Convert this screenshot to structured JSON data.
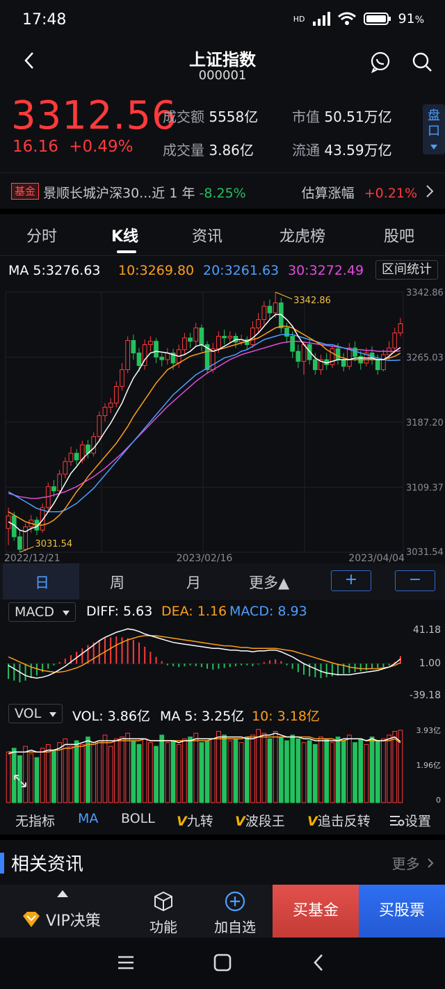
{
  "status": {
    "time": "17:48",
    "battery": "91",
    "battery_unit": "%",
    "network": "HD"
  },
  "header": {
    "title": "上证指数",
    "code": "000001"
  },
  "quote": {
    "price": "3312.56",
    "change": "16.16",
    "change_pct": "+0.49%",
    "turnover_label": "成交额",
    "turnover": "5558亿",
    "volume_label": "成交量",
    "volume": "3.86亿",
    "mktcap_label": "市值",
    "mktcap": "50.51万亿",
    "float_label": "流通",
    "float": "43.59万亿",
    "pankou": [
      "盘",
      "口"
    ]
  },
  "fund": {
    "badge": "基金",
    "name": "景顺长城沪深30...近 1 年",
    "return": "-8.25%",
    "est_label": "估算涨幅",
    "est_value": "+0.21%"
  },
  "tabs": [
    "分时",
    "K线",
    "资讯",
    "龙虎榜",
    "股吧"
  ],
  "ma_legend": {
    "ma5": "MA 5:3276.63",
    "ma10": "10:3269.80",
    "ma20": "20:3261.63",
    "ma30": "30:3272.49",
    "range_btn": "区间统计"
  },
  "periods": [
    "日",
    "周",
    "月",
    "更多▲"
  ],
  "zoom": {
    "plus": "+",
    "minus": "−"
  },
  "macd": {
    "selector": "MACD",
    "diff": "DIFF: 5.63",
    "dea": "DEA: 1.16",
    "macd": "MACD: 8.93",
    "ticks": [
      "41.18",
      "1.00",
      "-39.18"
    ]
  },
  "vol": {
    "selector": "VOL",
    "vol": "VOL: 3.86亿",
    "ma5": "MA 5: 3.25亿",
    "ma10": "10: 3.18亿",
    "ticks": [
      "3.93亿",
      "1.96亿",
      "0"
    ]
  },
  "indicators": [
    "无指标",
    "MA",
    "BOLL",
    "九转",
    "波段王",
    "追击反转",
    "设置"
  ],
  "news": {
    "title": "相关资讯",
    "more": "更多"
  },
  "actions": {
    "vip": "VIP决策",
    "func": "功能",
    "add": "加自选",
    "buy_fund": "买基金",
    "buy_stock": "买股票"
  },
  "colors": {
    "up": "#ff3b3b",
    "down": "#23c15d",
    "ma5": "#ffffff",
    "ma10": "#ff9f1a",
    "ma20": "#4d9fff",
    "ma30": "#e04ddb"
  },
  "chart_data": [
    {
      "type": "candlestick",
      "title": "",
      "x_labels": [
        "2022/12/21",
        "2023/02/16",
        "2023/04/04"
      ],
      "y_ticks": [
        "3342.86",
        "3265.03",
        "3187.20",
        "3109.37",
        "3031.54"
      ],
      "ylim": [
        3031.54,
        3342.86
      ],
      "high_label": "3342.86",
      "low_label": "3031.54",
      "bars": [
        [
          3060,
          3075,
          3040,
          3085
        ],
        [
          3075,
          3050,
          3045,
          3080
        ],
        [
          3050,
          3035,
          3031.54,
          3058
        ],
        [
          3035,
          3062,
          3033,
          3066
        ],
        [
          3062,
          3070,
          3055,
          3076
        ],
        [
          3070,
          3058,
          3052,
          3074
        ],
        [
          3058,
          3085,
          3055,
          3090
        ],
        [
          3085,
          3110,
          3082,
          3115
        ],
        [
          3110,
          3105,
          3098,
          3118
        ],
        [
          3105,
          3125,
          3100,
          3130
        ],
        [
          3125,
          3140,
          3120,
          3145
        ],
        [
          3140,
          3150,
          3135,
          3158
        ],
        [
          3150,
          3142,
          3136,
          3155
        ],
        [
          3142,
          3160,
          3138,
          3165
        ],
        [
          3160,
          3150,
          3144,
          3166
        ],
        [
          3150,
          3170,
          3146,
          3175
        ],
        [
          3170,
          3195,
          3165,
          3200
        ],
        [
          3195,
          3205,
          3188,
          3210
        ],
        [
          3205,
          3210,
          3198,
          3216
        ],
        [
          3210,
          3230,
          3205,
          3236
        ],
        [
          3230,
          3250,
          3225,
          3258
        ],
        [
          3250,
          3285,
          3246,
          3290
        ],
        [
          3285,
          3270,
          3262,
          3292
        ],
        [
          3270,
          3255,
          3248,
          3276
        ],
        [
          3255,
          3280,
          3250,
          3286
        ],
        [
          3280,
          3284,
          3272,
          3290
        ],
        [
          3284,
          3265,
          3258,
          3288
        ],
        [
          3265,
          3262,
          3254,
          3270
        ],
        [
          3262,
          3270,
          3256,
          3276
        ],
        [
          3270,
          3258,
          3250,
          3275
        ],
        [
          3258,
          3274,
          3252,
          3280
        ],
        [
          3274,
          3288,
          3268,
          3294
        ],
        [
          3288,
          3284,
          3276,
          3294
        ],
        [
          3284,
          3300,
          3278,
          3306
        ],
        [
          3300,
          3280,
          3272,
          3304
        ],
        [
          3280,
          3250,
          3245,
          3284
        ],
        [
          3250,
          3275,
          3246,
          3282
        ],
        [
          3275,
          3290,
          3270,
          3296
        ],
        [
          3290,
          3288,
          3280,
          3298
        ],
        [
          3288,
          3290,
          3282,
          3296
        ],
        [
          3290,
          3283,
          3276,
          3294
        ],
        [
          3283,
          3286,
          3279,
          3292
        ],
        [
          3286,
          3280,
          3274,
          3290
        ],
        [
          3280,
          3300,
          3276,
          3308
        ],
        [
          3300,
          3310,
          3294,
          3318
        ],
        [
          3310,
          3326,
          3304,
          3332
        ],
        [
          3326,
          3318,
          3310,
          3334
        ],
        [
          3318,
          3330,
          3312,
          3342.86
        ],
        [
          3330,
          3300,
          3294,
          3336
        ],
        [
          3300,
          3290,
          3282,
          3306
        ],
        [
          3290,
          3272,
          3264,
          3296
        ],
        [
          3272,
          3260,
          3252,
          3280
        ],
        [
          3260,
          3280,
          3244,
          3284
        ],
        [
          3280,
          3262,
          3256,
          3288
        ],
        [
          3262,
          3250,
          3244,
          3270
        ],
        [
          3250,
          3262,
          3244,
          3268
        ],
        [
          3262,
          3256,
          3250,
          3270
        ],
        [
          3256,
          3275,
          3252,
          3280
        ],
        [
          3275,
          3262,
          3256,
          3282
        ],
        [
          3262,
          3254,
          3248,
          3270
        ],
        [
          3254,
          3276,
          3250,
          3282
        ],
        [
          3276,
          3266,
          3260,
          3284
        ],
        [
          3266,
          3258,
          3250,
          3272
        ],
        [
          3258,
          3270,
          3254,
          3276
        ],
        [
          3270,
          3262,
          3256,
          3278
        ],
        [
          3262,
          3250,
          3244,
          3268
        ],
        [
          3250,
          3268,
          3248,
          3274
        ],
        [
          3268,
          3276,
          3262,
          3284
        ],
        [
          3276,
          3294,
          3270,
          3300
        ],
        [
          3294,
          3305,
          3290,
          3312
        ]
      ],
      "ma5": [
        3068,
        3064,
        3058,
        3056,
        3060,
        3062,
        3070,
        3080,
        3090,
        3102,
        3114,
        3126,
        3134,
        3143,
        3150,
        3156,
        3165,
        3176,
        3186,
        3198,
        3210,
        3226,
        3240,
        3250,
        3262,
        3270,
        3272,
        3271,
        3270,
        3268,
        3266,
        3268,
        3272,
        3278,
        3280,
        3276,
        3272,
        3274,
        3278,
        3282,
        3286,
        3286,
        3284,
        3288,
        3294,
        3302,
        3310,
        3316,
        3316,
        3310,
        3302,
        3290,
        3280,
        3272,
        3264,
        3260,
        3258,
        3260,
        3262,
        3262,
        3262,
        3264,
        3264,
        3264,
        3264,
        3262,
        3262,
        3266,
        3272,
        3276.63
      ],
      "ma10": [
        3080,
        3076,
        3072,
        3068,
        3066,
        3064,
        3064,
        3066,
        3070,
        3076,
        3084,
        3094,
        3104,
        3112,
        3122,
        3130,
        3138,
        3146,
        3154,
        3162,
        3172,
        3182,
        3194,
        3204,
        3214,
        3224,
        3234,
        3242,
        3250,
        3254,
        3258,
        3262,
        3266,
        3268,
        3270,
        3272,
        3272,
        3274,
        3276,
        3278,
        3280,
        3282,
        3284,
        3286,
        3288,
        3292,
        3296,
        3300,
        3302,
        3302,
        3300,
        3296,
        3292,
        3288,
        3284,
        3280,
        3274,
        3270,
        3266,
        3264,
        3262,
        3262,
        3262,
        3262,
        3262,
        3262,
        3262,
        3264,
        3266,
        3269.8
      ],
      "ma20": [
        3104,
        3100,
        3096,
        3092,
        3088,
        3084,
        3082,
        3080,
        3080,
        3080,
        3082,
        3086,
        3090,
        3096,
        3102,
        3108,
        3116,
        3124,
        3132,
        3140,
        3148,
        3156,
        3164,
        3172,
        3180,
        3188,
        3196,
        3204,
        3212,
        3220,
        3226,
        3232,
        3238,
        3244,
        3248,
        3252,
        3256,
        3260,
        3264,
        3266,
        3268,
        3272,
        3274,
        3278,
        3282,
        3286,
        3288,
        3290,
        3292,
        3292,
        3292,
        3290,
        3288,
        3286,
        3284,
        3282,
        3280,
        3280,
        3278,
        3276,
        3274,
        3272,
        3270,
        3268,
        3266,
        3264,
        3262,
        3261,
        3261,
        3261.63
      ],
      "ma30": [
        3102,
        3100,
        3098,
        3097,
        3096,
        3096,
        3097,
        3098,
        3100,
        3102,
        3104,
        3107,
        3110,
        3114,
        3118,
        3122,
        3127,
        3132,
        3138,
        3144,
        3150,
        3157,
        3164,
        3171,
        3178,
        3185,
        3192,
        3199,
        3206,
        3212,
        3218,
        3224,
        3230,
        3236,
        3241,
        3246,
        3250,
        3254,
        3258,
        3262,
        3265,
        3268,
        3270,
        3272,
        3274,
        3276,
        3278,
        3280,
        3282,
        3283,
        3284,
        3284,
        3283,
        3282,
        3281,
        3280,
        3279,
        3278,
        3277,
        3276,
        3275,
        3274,
        3274,
        3273,
        3273,
        3272,
        3272,
        3272,
        3272,
        3272.49
      ]
    },
    {
      "type": "bar",
      "name": "MACD",
      "ylim": [
        -39.18,
        41.18
      ],
      "hist": [
        -18,
        -20,
        -22,
        -20,
        -17,
        -14,
        -10,
        -6,
        -2,
        2,
        6,
        10,
        14,
        18,
        22,
        25,
        28,
        30,
        31,
        32,
        31,
        30,
        28,
        25,
        20,
        14,
        8,
        3,
        -2,
        -3,
        -4,
        -3,
        -2,
        -3,
        -4,
        -6,
        -7,
        -6,
        -5,
        -4,
        -3,
        -2,
        -2,
        -3,
        -1,
        2,
        4,
        5,
        3,
        -2,
        -6,
        -10,
        -13,
        -15,
        -16,
        -17,
        -16,
        -15,
        -14,
        -12,
        -11,
        -10,
        -9,
        -8,
        -6,
        -5,
        -4,
        -2,
        2,
        8.93
      ],
      "diff": [
        -2,
        -6,
        -10,
        -14,
        -16,
        -17,
        -16,
        -14,
        -11,
        -7,
        -3,
        2,
        7,
        12,
        17,
        22,
        27,
        31,
        34,
        37,
        39,
        41,
        40,
        38,
        35,
        33,
        31,
        29,
        27,
        25,
        24,
        23,
        22,
        21,
        20,
        19,
        18,
        18,
        17,
        16,
        16,
        15,
        15,
        14,
        15,
        15,
        16,
        16,
        14,
        11,
        8,
        4,
        0,
        -3,
        -6,
        -9,
        -11,
        -12,
        -13,
        -13,
        -13,
        -12,
        -11,
        -10,
        -9,
        -8,
        -6,
        -4,
        0,
        5.63
      ],
      "dea": [
        8,
        5,
        2,
        -1,
        -4,
        -6,
        -8,
        -9,
        -10,
        -10,
        -9,
        -7,
        -5,
        -2,
        2,
        6,
        10,
        14,
        18,
        22,
        25,
        28,
        30,
        32,
        33,
        33,
        33,
        32,
        31,
        30,
        29,
        28,
        27,
        26,
        25,
        24,
        23,
        22,
        21,
        21,
        20,
        19,
        19,
        18,
        18,
        18,
        18,
        18,
        17,
        16,
        15,
        13,
        11,
        9,
        7,
        5,
        3,
        1,
        -1,
        -2,
        -4,
        -5,
        -6,
        -6,
        -6,
        -6,
        -5,
        -4,
        -2,
        1.16
      ]
    },
    {
      "type": "bar",
      "name": "VOL",
      "ylim": [
        0,
        3.93
      ],
      "values": [
        2.7,
        2.9,
        2.5,
        3.0,
        2.6,
        2.4,
        2.9,
        3.1,
        2.8,
        3.2,
        3.4,
        3.0,
        3.3,
        3.1,
        3.5,
        3.2,
        3.3,
        3.6,
        3.0,
        3.4,
        3.5,
        3.7,
        3.3,
        3.1,
        3.4,
        3.2,
        3.0,
        3.6,
        3.2,
        3.3,
        3.1,
        3.4,
        3.5,
        3.7,
        3.2,
        3.3,
        3.4,
        3.8,
        3.6,
        3.3,
        3.4,
        3.2,
        3.5,
        3.6,
        3.9,
        3.7,
        3.4,
        3.8,
        3.5,
        3.3,
        3.6,
        3.4,
        3.2,
        3.3,
        3.1,
        3.5,
        3.4,
        3.2,
        3.5,
        3.3,
        3.6,
        3.2,
        3.4,
        3.1,
        3.5,
        3.3,
        3.4,
        3.6,
        3.8,
        3.86
      ],
      "ma5": [
        2.6,
        2.7,
        2.7,
        2.7,
        2.8,
        2.7,
        2.7,
        2.8,
        2.8,
        2.9,
        3.1,
        3.1,
        3.1,
        3.2,
        3.3,
        3.2,
        3.3,
        3.3,
        3.3,
        3.3,
        3.4,
        3.4,
        3.4,
        3.4,
        3.4,
        3.3,
        3.3,
        3.3,
        3.3,
        3.3,
        3.2,
        3.3,
        3.3,
        3.4,
        3.4,
        3.4,
        3.4,
        3.5,
        3.5,
        3.5,
        3.5,
        3.5,
        3.4,
        3.4,
        3.5,
        3.6,
        3.6,
        3.7,
        3.6,
        3.5,
        3.5,
        3.5,
        3.4,
        3.4,
        3.3,
        3.3,
        3.3,
        3.3,
        3.3,
        3.4,
        3.4,
        3.4,
        3.4,
        3.3,
        3.4,
        3.3,
        3.3,
        3.4,
        3.5,
        3.25
      ],
      "ma10": [
        2.7,
        2.7,
        2.7,
        2.7,
        2.7,
        2.7,
        2.7,
        2.7,
        2.8,
        2.8,
        2.9,
        2.9,
        3.0,
        3.0,
        3.1,
        3.1,
        3.2,
        3.2,
        3.2,
        3.3,
        3.3,
        3.3,
        3.3,
        3.3,
        3.4,
        3.3,
        3.3,
        3.3,
        3.3,
        3.3,
        3.3,
        3.3,
        3.3,
        3.3,
        3.3,
        3.3,
        3.4,
        3.4,
        3.4,
        3.4,
        3.4,
        3.4,
        3.5,
        3.5,
        3.5,
        3.5,
        3.5,
        3.5,
        3.5,
        3.5,
        3.5,
        3.5,
        3.5,
        3.5,
        3.4,
        3.4,
        3.4,
        3.4,
        3.3,
        3.3,
        3.4,
        3.4,
        3.4,
        3.3,
        3.3,
        3.3,
        3.3,
        3.3,
        3.4,
        3.18
      ]
    }
  ]
}
